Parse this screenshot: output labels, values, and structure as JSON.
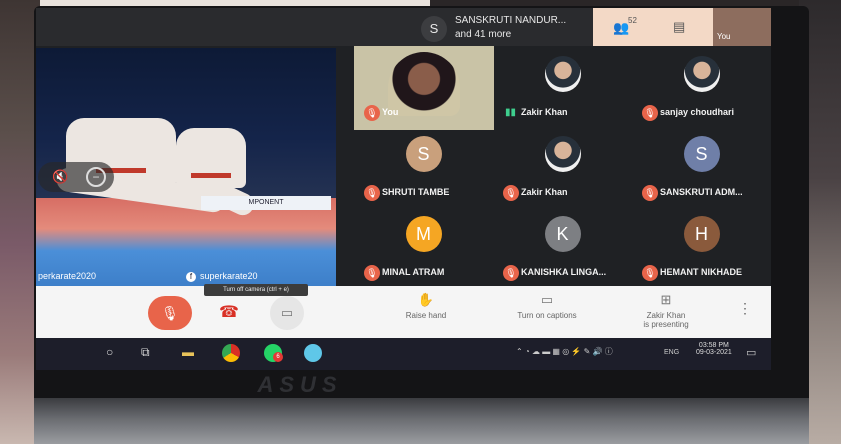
{
  "header": {
    "host_initial": "S",
    "host_name": "SANSKRUTI NANDUR...",
    "host_more": "and 41 more",
    "people_count": "52",
    "people_icon": "people-icon",
    "chat_icon": "chat-icon",
    "self_strip_label": "You"
  },
  "presentation": {
    "banner": "MPONENT",
    "watermark_left": "perkarate2020",
    "watermark_right": "superkarate20",
    "watermark_right_icon": "f"
  },
  "participants": [
    {
      "name": "You",
      "initial": "",
      "color": "",
      "mic": "off"
    },
    {
      "name": "Zakir Khan",
      "initial": "",
      "color": "",
      "mic": "on"
    },
    {
      "name": "sanjay choudhari",
      "initial": "",
      "color": "",
      "mic": "off"
    },
    {
      "name": "SHRUTI TAMBE",
      "initial": "S",
      "color": "#c9a07c",
      "mic": "off"
    },
    {
      "name": "Zakir Khan",
      "initial": "",
      "color": "",
      "mic": "off"
    },
    {
      "name": "SANSKRUTI ADM...",
      "initial": "S",
      "color": "#6f7fa8",
      "mic": "off"
    },
    {
      "name": "MINAL ATRAM",
      "initial": "M",
      "color": "#f5a623",
      "mic": "off"
    },
    {
      "name": "KANISHKA LINGA...",
      "initial": "K",
      "color": "#7d7f83",
      "mic": "off"
    },
    {
      "name": "HEMANT NIKHADE",
      "initial": "H",
      "color": "#8a5a3c",
      "mic": "off"
    }
  ],
  "controls": {
    "camera_tooltip": "Turn off camera (ctrl + e)",
    "raise_hand": "Raise hand",
    "captions": "Turn on captions",
    "presenting_line1": "Zakir Khan",
    "presenting_line2": "is presenting",
    "more": "⋮"
  },
  "taskbar": {
    "whatsapp_badge": "6",
    "lang": "ENG",
    "time": "03:58 PM",
    "date": "09-03-2021"
  },
  "laptop": {
    "brand": "ASUS"
  }
}
